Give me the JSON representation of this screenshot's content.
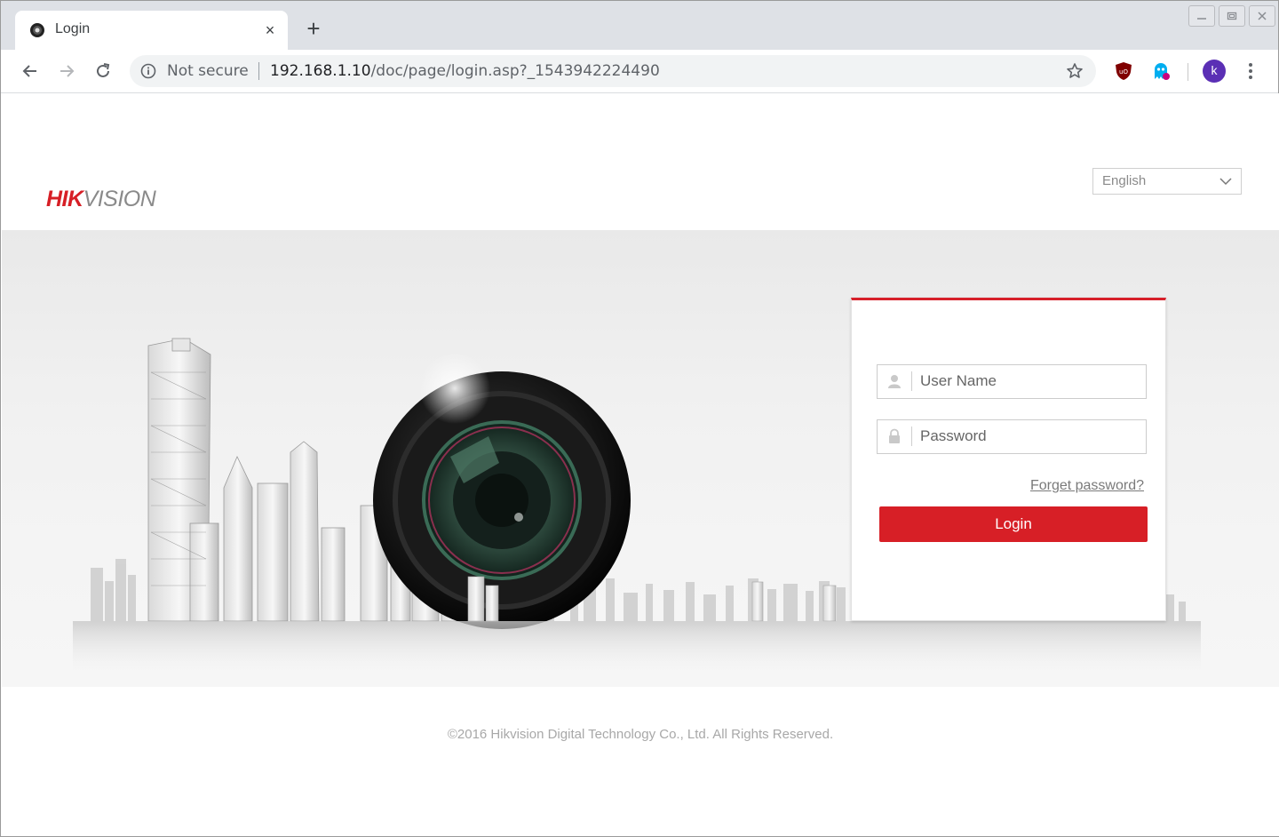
{
  "browser": {
    "tab": {
      "title": "Login",
      "close_glyph": "×",
      "favicon": "hikvision-favicon"
    },
    "new_tab_glyph": "+",
    "omnibox": {
      "security_label": "Not secure",
      "url_host": "192.168.1.10",
      "url_path": "/doc/page/login.asp?_1543942224490"
    },
    "profile_initial": "k",
    "extensions": [
      "ublock-origin-icon",
      "ghostery-icon"
    ],
    "icons": [
      "back-arrow-icon",
      "forward-arrow-icon",
      "reload-icon",
      "info-icon",
      "star-icon",
      "menu-dots-icon"
    ]
  },
  "page": {
    "brand": {
      "name": "HIKVISION",
      "accent_color": "#d71f26"
    },
    "language_select": {
      "selected": "English"
    },
    "login": {
      "username_placeholder": "User Name",
      "password_placeholder": "Password",
      "forgot_label": "Forget password?",
      "submit_label": "Login",
      "button_color": "#d71f26"
    },
    "footer": "©2016 Hikvision Digital Technology Co., Ltd. All Rights Reserved."
  }
}
